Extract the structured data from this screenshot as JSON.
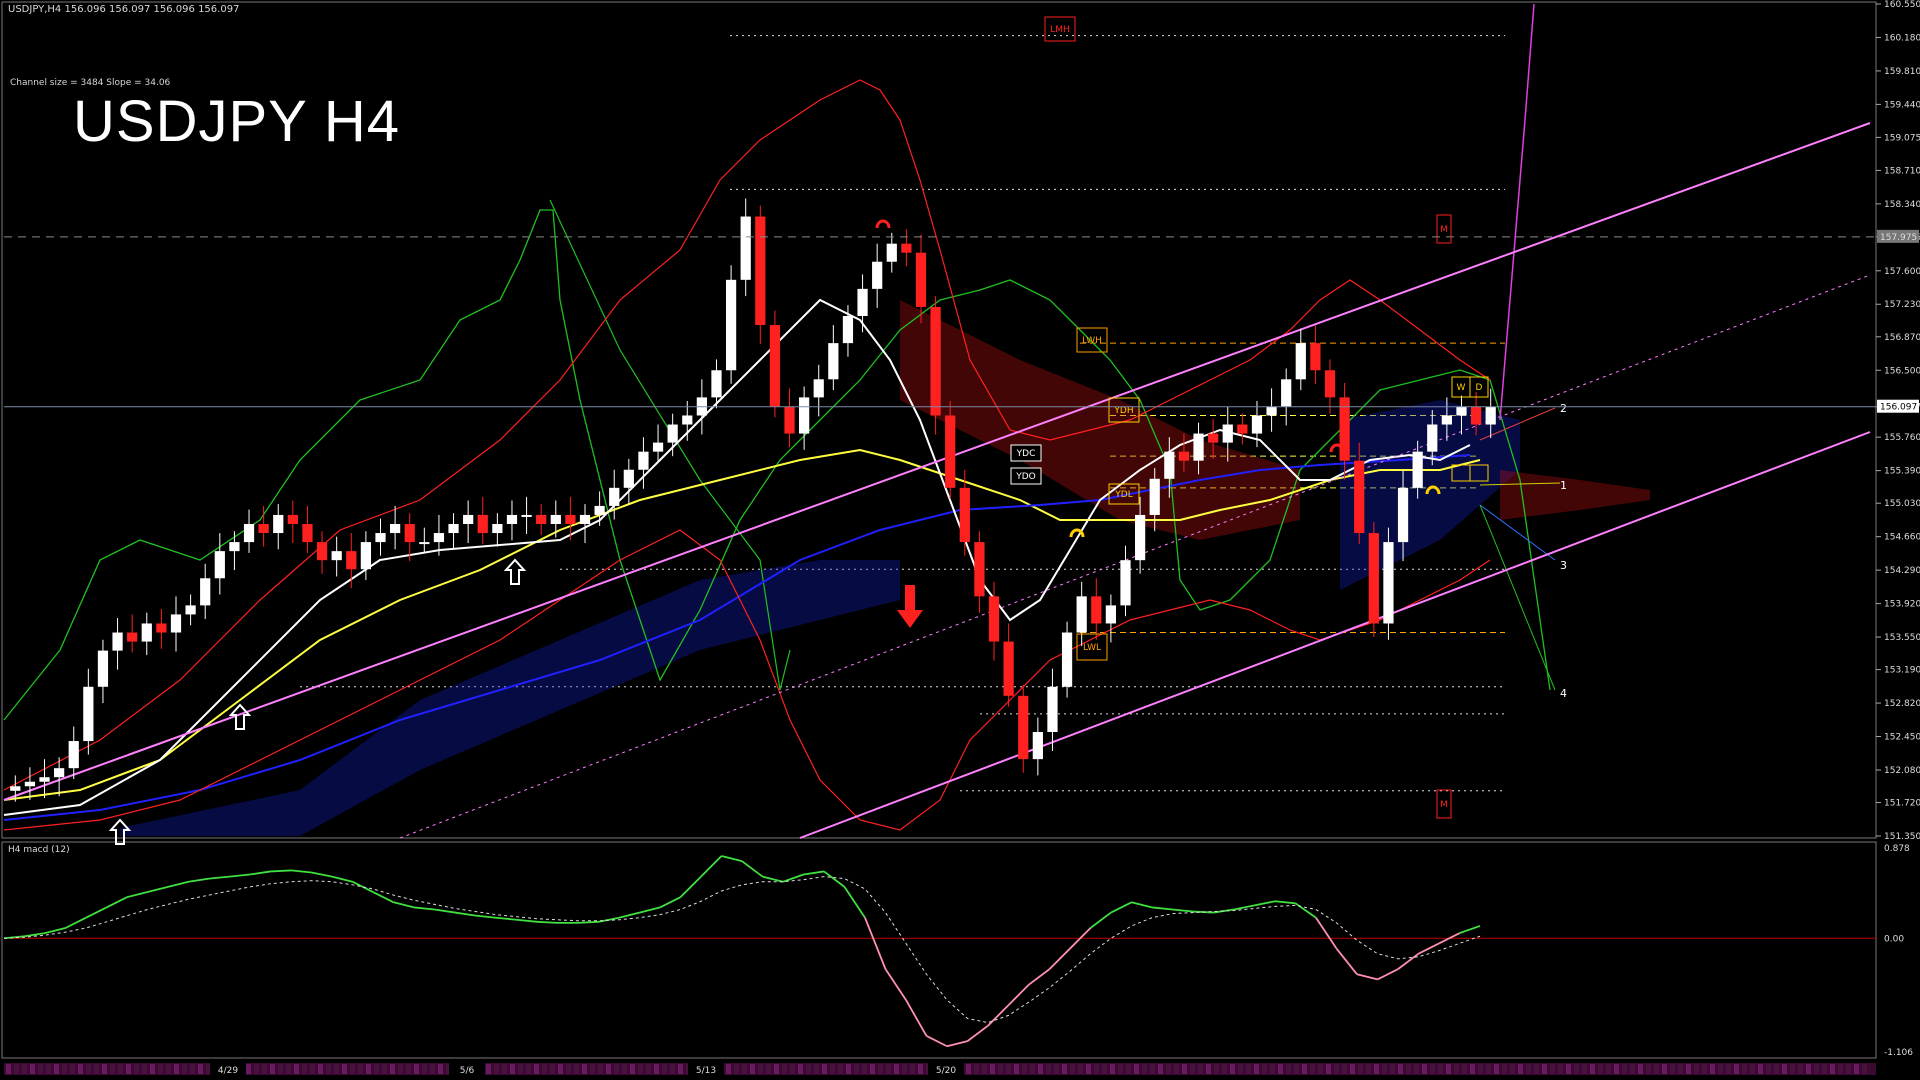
{
  "window": {
    "header": "USDJPY,H4  156.096 156.097 156.096 156.097",
    "channel_info": "Channel size = 3484 Slope = 34.06",
    "big_title": "USDJPY H4",
    "sub_indicator_label": "H4  macd (12)"
  },
  "colors": {
    "background": "#000000",
    "bull_candle": "#ffffff",
    "bear_candle": "#ff2020",
    "channel": "#ff80ff",
    "bollinger": "#ff2020",
    "green_line": "#20c020",
    "yellow_ma": "#ffff40",
    "blue_ma": "#2020ff",
    "white_ma": "#ffffff",
    "macd_main": "#40e040",
    "macd_negative": "#ff90b0",
    "level_orange": "#ffa000"
  },
  "chart_data": {
    "type": "candlestick",
    "symbol": "USDJPY",
    "timeframe": "H4",
    "ohlc_header": {
      "open": 156.096,
      "high": 156.097,
      "low": 156.096,
      "close": 156.097
    },
    "ylim": [
      151.35,
      160.55
    ],
    "price_ticks": [
      "160.550",
      "160.180",
      "159.810",
      "159.440",
      "159.075",
      "158.710",
      "158.340",
      "157.975",
      "157.600",
      "157.230",
      "156.870",
      "156.500",
      "156.097",
      "155.760",
      "155.390",
      "155.030",
      "154.660",
      "154.290",
      "153.920",
      "153.550",
      "153.190",
      "152.820",
      "152.450",
      "152.080",
      "151.720",
      "151.350"
    ],
    "current_price_label": "156.097",
    "highlighted_level_label": "157.975",
    "date_labels": [
      "4/29",
      "5/6",
      "5/13",
      "5/20"
    ],
    "closes": [
      151.9,
      151.95,
      152.0,
      152.1,
      152.4,
      153.0,
      153.4,
      153.6,
      153.5,
      153.7,
      153.6,
      153.8,
      153.9,
      154.2,
      154.5,
      154.6,
      154.8,
      154.7,
      154.9,
      154.8,
      154.6,
      154.4,
      154.5,
      154.3,
      154.6,
      154.7,
      154.8,
      154.6,
      154.6,
      154.7,
      154.8,
      154.9,
      154.7,
      154.8,
      154.9,
      154.9,
      154.8,
      154.9,
      154.8,
      154.9,
      155.0,
      155.2,
      155.4,
      155.6,
      155.7,
      155.9,
      156.0,
      156.2,
      156.5,
      157.5,
      158.2,
      157.0,
      156.1,
      155.8,
      156.2,
      156.4,
      156.8,
      157.1,
      157.4,
      157.7,
      157.9,
      157.8,
      157.2,
      156.0,
      155.2,
      154.6,
      154.0,
      153.5,
      152.9,
      152.2,
      152.5,
      153.0,
      153.6,
      154.0,
      153.7,
      153.9,
      154.4,
      154.9,
      155.3,
      155.6,
      155.5,
      155.8,
      155.7,
      155.9,
      155.8,
      156.0,
      156.1,
      156.4,
      156.8,
      156.5,
      156.2,
      155.5,
      154.7,
      153.7,
      154.6,
      155.2,
      155.6,
      155.9,
      156.0,
      156.1,
      155.9,
      156.097
    ],
    "candle_count": 102,
    "channel_labels": [
      "1",
      "2",
      "3",
      "4"
    ],
    "level_boxes": [
      "LMH",
      "LWH",
      "YDH",
      "YDC",
      "YDO",
      "YDL",
      "LWL",
      "W",
      "D",
      "M",
      "M"
    ],
    "macd": {
      "ylim": [
        -1.106,
        0.878
      ],
      "ticks": [
        "0.878",
        "0.00",
        "-1.106"
      ],
      "main": [
        0.0,
        0.02,
        0.05,
        0.1,
        0.2,
        0.3,
        0.4,
        0.45,
        0.5,
        0.55,
        0.58,
        0.6,
        0.62,
        0.65,
        0.66,
        0.64,
        0.6,
        0.55,
        0.45,
        0.35,
        0.3,
        0.28,
        0.25,
        0.22,
        0.2,
        0.18,
        0.16,
        0.15,
        0.15,
        0.16,
        0.2,
        0.25,
        0.3,
        0.4,
        0.6,
        0.8,
        0.75,
        0.6,
        0.55,
        0.62,
        0.65,
        0.5,
        0.2,
        -0.3,
        -0.6,
        -0.95,
        -1.05,
        -1.0,
        -0.85,
        -0.65,
        -0.45,
        -0.3,
        -0.1,
        0.1,
        0.25,
        0.35,
        0.3,
        0.28,
        0.26,
        0.25,
        0.28,
        0.32,
        0.36,
        0.34,
        0.2,
        -0.1,
        -0.35,
        -0.4,
        -0.3,
        -0.15,
        -0.05,
        0.05,
        0.12
      ],
      "signal": [
        0.0,
        0.01,
        0.03,
        0.06,
        0.1,
        0.16,
        0.22,
        0.28,
        0.33,
        0.38,
        0.42,
        0.46,
        0.5,
        0.53,
        0.55,
        0.56,
        0.55,
        0.52,
        0.48,
        0.42,
        0.37,
        0.33,
        0.29,
        0.26,
        0.23,
        0.21,
        0.19,
        0.18,
        0.17,
        0.17,
        0.18,
        0.2,
        0.23,
        0.28,
        0.36,
        0.46,
        0.52,
        0.55,
        0.55,
        0.57,
        0.6,
        0.58,
        0.48,
        0.25,
        -0.05,
        -0.35,
        -0.6,
        -0.78,
        -0.82,
        -0.75,
        -0.62,
        -0.48,
        -0.32,
        -0.15,
        0.0,
        0.12,
        0.2,
        0.24,
        0.25,
        0.26,
        0.27,
        0.29,
        0.31,
        0.32,
        0.28,
        0.15,
        -0.02,
        -0.15,
        -0.2,
        -0.18,
        -0.12,
        -0.05,
        0.02
      ]
    }
  }
}
